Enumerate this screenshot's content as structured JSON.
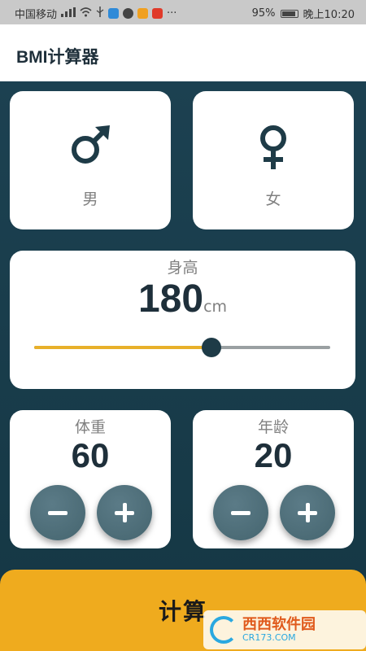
{
  "status_bar": {
    "carrier": "中国移动",
    "battery": "95%",
    "time": "晚上10:20",
    "icons": [
      "signal-icon",
      "wifi-icon",
      "usb-icon",
      "app-icon",
      "app-icon",
      "app-icon",
      "app-icon",
      "more-icon"
    ]
  },
  "app_bar": {
    "title": "BMI计算器"
  },
  "gender": {
    "male_label": "男",
    "female_label": "女",
    "male_icon": "male-symbol-icon",
    "female_icon": "female-symbol-icon"
  },
  "height": {
    "label": "身高",
    "value": "180",
    "unit": "cm",
    "slider_fraction": 0.6
  },
  "weight": {
    "label": "体重",
    "value": "60"
  },
  "age": {
    "label": "年龄",
    "value": "20"
  },
  "calculate": {
    "label": "计算"
  },
  "watermark": {
    "main": "西西软件园",
    "sub": "CR173.COM"
  },
  "colors": {
    "primary_dark": "#1e2f3a",
    "background": "#1c4151",
    "accent": "#efab1e",
    "button": "#4f707b"
  }
}
